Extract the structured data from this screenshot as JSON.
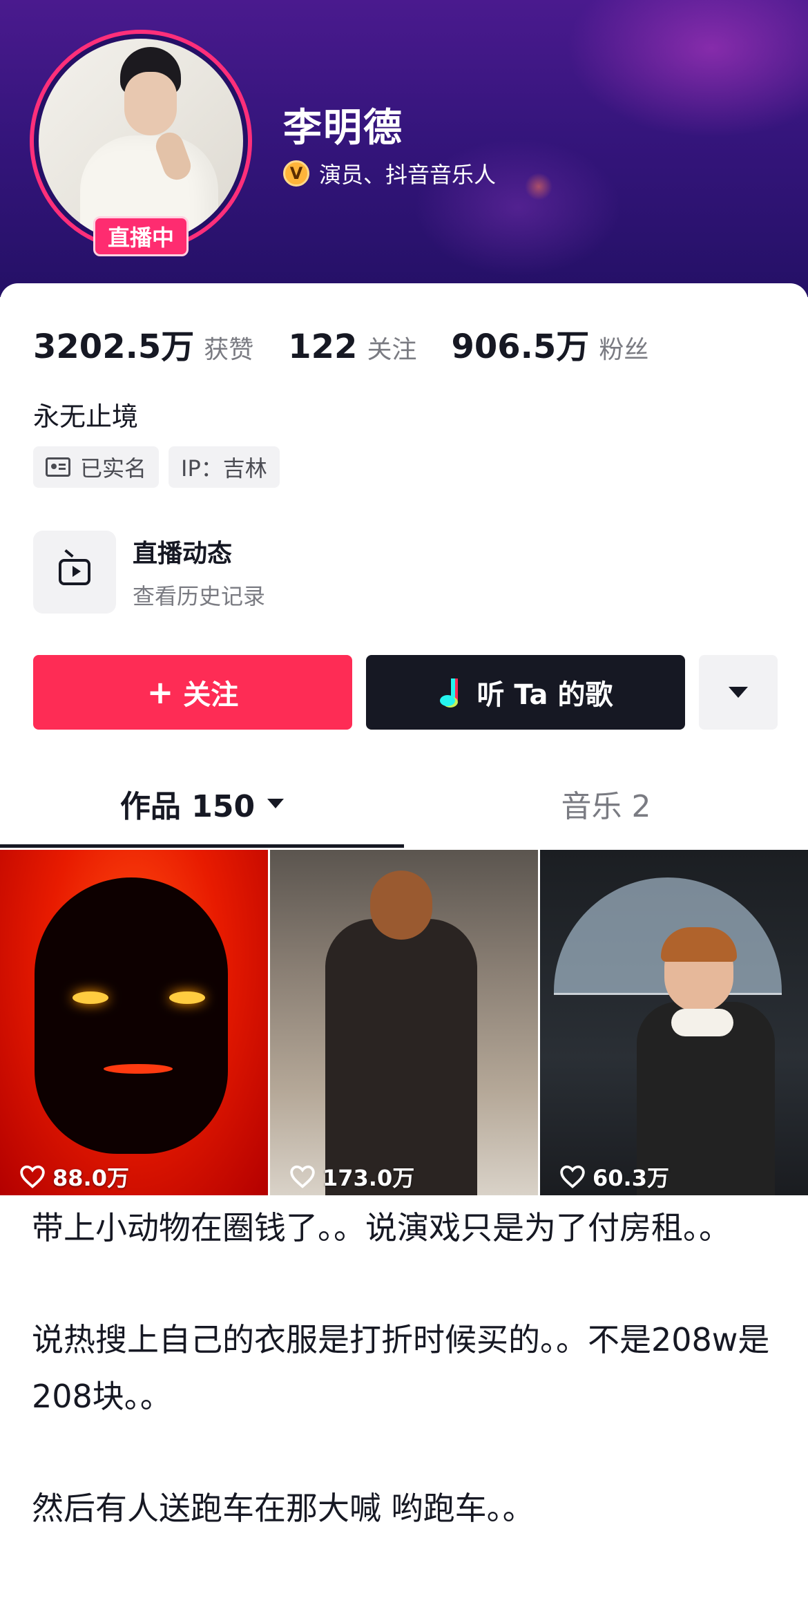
{
  "profile": {
    "name": "李明德",
    "verify_badge": "V",
    "verify_text": "演员、抖音音乐人",
    "live_badge": "直播中"
  },
  "stats": [
    {
      "value": "3202.5万",
      "label": "获赞"
    },
    {
      "value": "122",
      "label": "关注"
    },
    {
      "value": "906.5万",
      "label": "粉丝"
    }
  ],
  "bio": "永无止境",
  "tags": {
    "verified": "已实名",
    "ip": "IP：吉林"
  },
  "live_entry": {
    "title": "直播动态",
    "subtitle": "查看历史记录"
  },
  "actions": {
    "follow_plus": "+",
    "follow_label": "关注",
    "music_label": "听 Ta 的歌"
  },
  "tabs": {
    "works": "作品 150",
    "music": "音乐 2"
  },
  "videos": [
    {
      "likes": "88.0万"
    },
    {
      "likes": "173.0万"
    },
    {
      "likes": "60.3万"
    }
  ],
  "caption": {
    "para1": "带上小动物在圈钱了。。说演戏只是为了付房租。。",
    "para2": "说热搜上自己的衣服是打折时候买的。。不是208w是208块。。",
    "para3": "然后有人送跑车在那大喊 哟跑车。。"
  },
  "colors": {
    "accent": "#fe2c55",
    "header": "#35157c",
    "dark_button": "#161823"
  }
}
